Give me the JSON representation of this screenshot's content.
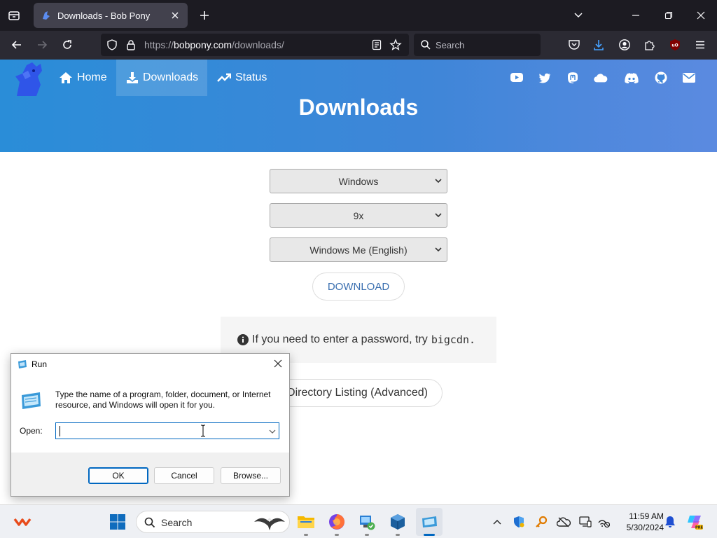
{
  "browser": {
    "tab": {
      "title": "Downloads - Bob Pony"
    },
    "url": {
      "scheme": "https://",
      "domain": "bobpony.com",
      "path": "/downloads/"
    },
    "search_placeholder": "Search"
  },
  "site": {
    "nav": {
      "home": "Home",
      "downloads": "Downloads",
      "status": "Status"
    },
    "heading": "Downloads",
    "selects": {
      "os": "Windows",
      "version": "9x",
      "edition": "Windows Me (English)"
    },
    "download_button": "DOWNLOAD",
    "notice": {
      "text": "If you need to enter a password, try",
      "code": "bigcdn."
    },
    "directory_button": "Directory Listing (Advanced)",
    "social_icons": [
      "youtube-icon",
      "twitter-icon",
      "mastodon-icon",
      "cloud-icon",
      "discord-icon",
      "github-icon",
      "mail-icon"
    ],
    "colors": {
      "header": "#3f86d8"
    }
  },
  "run_dialog": {
    "title": "Run",
    "description": "Type the name of a program, folder, document, or Internet resource, and Windows will open it for you.",
    "open_label": "Open:",
    "open_value": "",
    "ok": "OK",
    "cancel": "Cancel",
    "browse": "Browse..."
  },
  "taskbar": {
    "search_label": "Search",
    "time": "11:59 AM",
    "date": "5/30/2024"
  }
}
